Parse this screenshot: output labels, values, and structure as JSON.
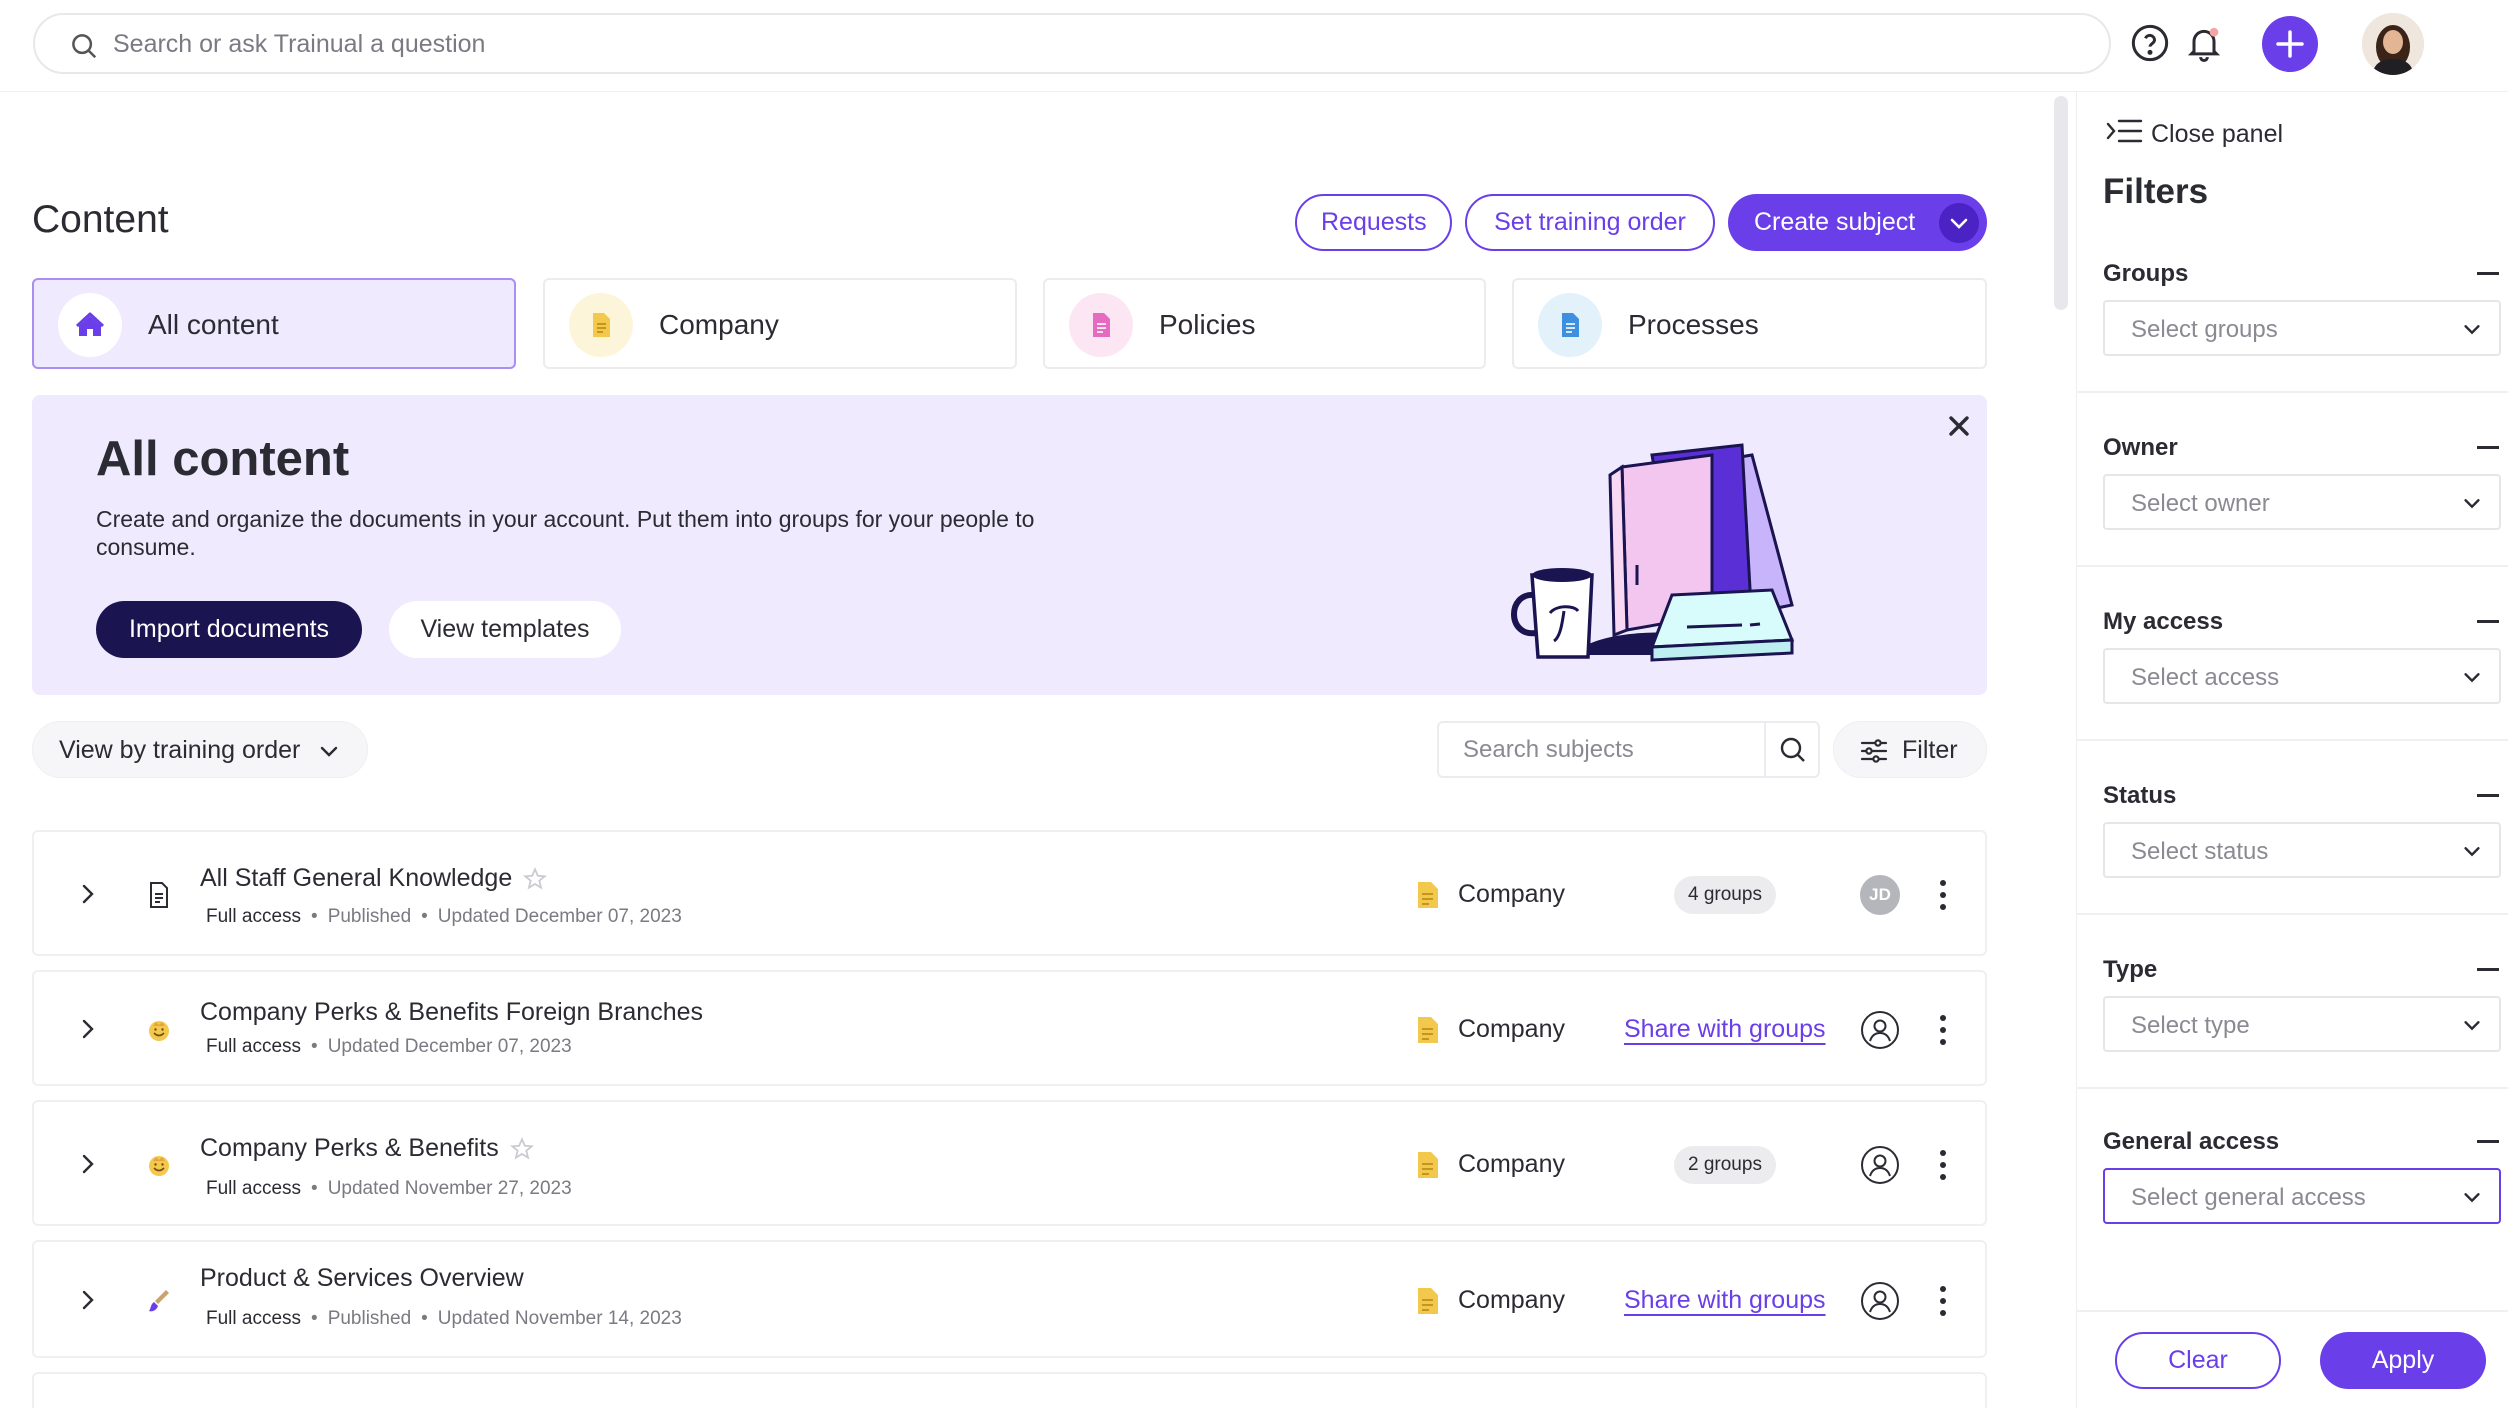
{
  "search": {
    "placeholder": "Search or ask Trainual a question"
  },
  "page": {
    "title": "Content"
  },
  "header_buttons": {
    "requests": "Requests",
    "set_training_order": "Set training order",
    "create_subject": "Create subject"
  },
  "categories": [
    {
      "label": "All content",
      "icon": "home-icon",
      "active": true
    },
    {
      "label": "Company",
      "icon": "company-doc-icon"
    },
    {
      "label": "Policies",
      "icon": "policy-doc-icon"
    },
    {
      "label": "Processes",
      "icon": "process-doc-icon"
    }
  ],
  "banner": {
    "title": "All content",
    "description": "Create and organize the documents in your account. Put them into groups for your people to consume.",
    "import_label": "Import documents",
    "templates_label": "View templates"
  },
  "toolbar": {
    "view_by": "View by training order",
    "search_placeholder": "Search subjects",
    "filter_label": "Filter"
  },
  "rows": [
    {
      "title": "All Staff General Knowledge",
      "access": "Full access",
      "published": "Published",
      "updated": "Updated December 07, 2023",
      "group_type": "Company",
      "groups_badge": "4 groups",
      "owner_initials": "JD",
      "starred": false
    },
    {
      "title": "Company Perks & Benefits Foreign Branches",
      "access": "Full access",
      "updated": "Updated December 07, 2023",
      "group_type": "Company",
      "share_label": "Share with groups"
    },
    {
      "title": "Company Perks & Benefits",
      "access": "Full access",
      "updated": "Updated November 27, 2023",
      "group_type": "Company",
      "groups_badge": "2 groups",
      "starred": false
    },
    {
      "title": "Product & Services Overview",
      "access": "Full access",
      "published": "Published",
      "updated": "Updated November 14, 2023",
      "group_type": "Company",
      "share_label": "Share with groups"
    }
  ],
  "panel": {
    "close_label": "Close panel",
    "title": "Filters",
    "filters": [
      {
        "label": "Groups",
        "placeholder": "Select groups"
      },
      {
        "label": "Owner",
        "placeholder": "Select owner"
      },
      {
        "label": "My access",
        "placeholder": "Select access"
      },
      {
        "label": "Status",
        "placeholder": "Select status"
      },
      {
        "label": "Type",
        "placeholder": "Select type"
      },
      {
        "label": "General access",
        "placeholder": "Select general access"
      }
    ],
    "clear_label": "Clear",
    "apply_label": "Apply"
  },
  "colors": {
    "accent": "#6a3ee8",
    "navy": "#1a1450",
    "banner_bg": "#efeafd",
    "company_yellow": "#f2c94c"
  }
}
